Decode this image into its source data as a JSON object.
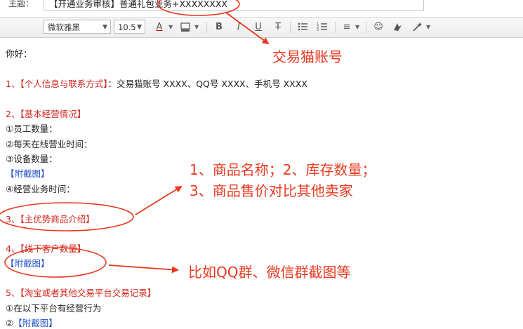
{
  "subject": {
    "label": "主题：",
    "text": "【开通业务审核】普通礼包业务+XXXXXXXX"
  },
  "toolbar": {
    "font_name": "微软雅黑",
    "font_size": "10.5",
    "font_color_glyph": "A",
    "bold_glyph": "B",
    "italic_glyph": "I",
    "underline_glyph": "U",
    "strike_glyph": "T",
    "align_glyph": "≡",
    "emoji_glyph": "☺",
    "icons": [
      "font-color-icon",
      "highlight-icon",
      "bold-icon",
      "italic-icon",
      "underline-icon",
      "strikethrough-icon",
      "bullet-list-icon",
      "numbered-list-icon",
      "align-icon",
      "emoji-icon",
      "screenshot-icon",
      "magic-wand-icon"
    ]
  },
  "body": {
    "greeting": "你好：",
    "s1_prefix": "1、【个人信息与联系方式】",
    "s1_text": "：交易猫账号 XXXX、QQ号 XXXX、手机号 XXXX",
    "s2_title": "2、【基本经营情况】",
    "s2_item1": "①员工数量：",
    "s2_item2": "②每天在线营业时间：",
    "s2_item3": "③设备数量：",
    "s2_attach": "【附截图】",
    "s2_item4": "④经营业务时间：",
    "s3_title": "3、【主优势商品介绍】",
    "s4_title": "4、【线下客户数量】",
    "s4_attach": "【附截图】",
    "s5_title": "5、【淘宝或者其他交易平台交易记录】",
    "s5_item1": "①在以下平台有经营行为",
    "s5_item2_prefix": "②",
    "s5_attach": "【附截图】"
  },
  "annotations": {
    "a1": "交易猫账号",
    "a2_line1": "1、商品名称；2、库存数量；",
    "a2_line2": "3、商品售价对比其他卖家",
    "a3": "比如QQ群、微信群截图等",
    "color": "#e8391f"
  },
  "colors": {
    "heading_red": "#d0241c",
    "attach_blue": "#1f4fc8",
    "annotation_red": "#e8391f"
  }
}
